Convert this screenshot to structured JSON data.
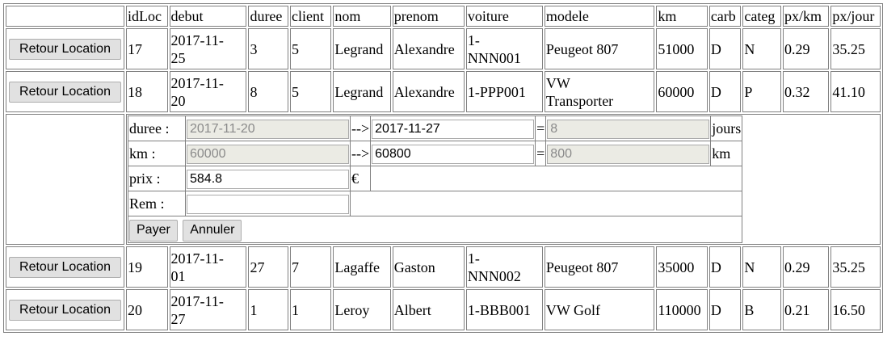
{
  "columns": [
    "idLoc",
    "debut",
    "duree",
    "client",
    "nom",
    "prenom",
    "voiture",
    "modele",
    "km",
    "carb",
    "categ",
    "px/km",
    "px/jour"
  ],
  "retour_label": "Retour Location",
  "rows_top": [
    {
      "idLoc": "17",
      "debut_1": "2017-11-",
      "debut_2": "25",
      "duree": "3",
      "client": "5",
      "nom": "Legrand",
      "prenom": "Alexandre",
      "voiture_1": "1-",
      "voiture_2": "NNN001",
      "modele_1": "Peugeot 807",
      "modele_2": "",
      "km": "51000",
      "carb": "D",
      "categ": "N",
      "pxkm": "0.29",
      "pxjour": "35.25"
    },
    {
      "idLoc": "18",
      "debut_1": "2017-11-",
      "debut_2": "20",
      "duree": "8",
      "client": "5",
      "nom": "Legrand",
      "prenom": "Alexandre",
      "voiture_1": "1-PPP001",
      "voiture_2": "",
      "modele_1": "VW",
      "modele_2": "Transporter",
      "km": "60000",
      "carb": "D",
      "categ": "P",
      "pxkm": "0.32",
      "pxjour": "41.10"
    }
  ],
  "form": {
    "duree_label": "duree :",
    "duree_start": "2017-11-20",
    "duree_end": "2017-11-27",
    "duree_result": "8",
    "duree_unit": "jours",
    "km_label": "km :",
    "km_start": "60000",
    "km_end": "60800",
    "km_result": "800",
    "km_unit": "km",
    "prix_label": "prix :",
    "prix_value": "584.8",
    "prix_unit": "€",
    "rem_label": "Rem :",
    "rem_value": "",
    "arrow": "-->",
    "equals": "=",
    "payer_label": "Payer",
    "annuler_label": "Annuler"
  },
  "rows_bottom": [
    {
      "idLoc": "19",
      "debut_1": "2017-11-",
      "debut_2": "01",
      "duree": "27",
      "client": "7",
      "nom": "Lagaffe",
      "prenom": "Gaston",
      "voiture_1": "1-",
      "voiture_2": "NNN002",
      "modele_1": "Peugeot 807",
      "modele_2": "",
      "km": "35000",
      "carb": "D",
      "categ": "N",
      "pxkm": "0.29",
      "pxjour": "35.25"
    },
    {
      "idLoc": "20",
      "debut_1": "2017-11-",
      "debut_2": "27",
      "duree": "1",
      "client": "1",
      "nom": "Leroy",
      "prenom": "Albert",
      "voiture_1": "1-BBB001",
      "voiture_2": "",
      "modele_1": "VW Golf",
      "modele_2": "",
      "km": "110000",
      "carb": "D",
      "categ": "B",
      "pxkm": "0.21",
      "pxjour": "16.50"
    }
  ]
}
